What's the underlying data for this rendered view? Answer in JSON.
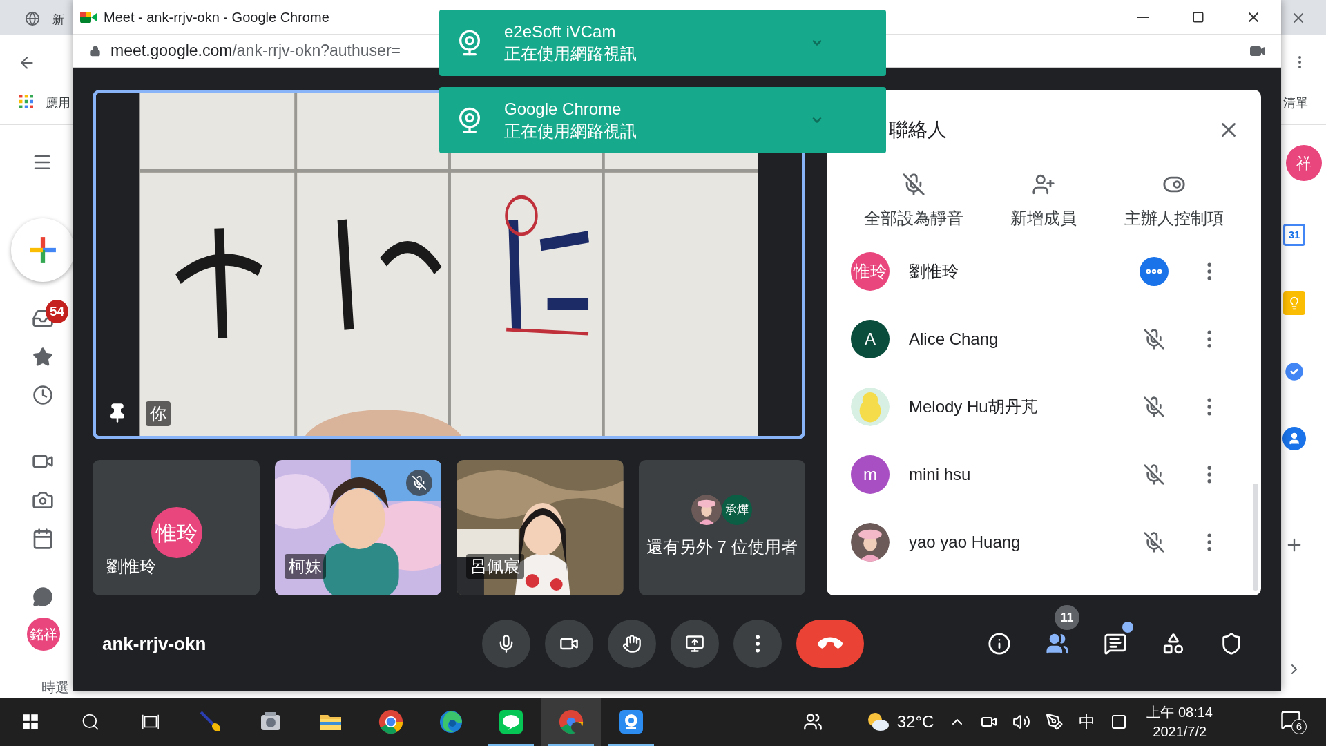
{
  "background_page": {
    "tab_title": "新",
    "bookmark": "應用",
    "right_bookmark": "清單",
    "inbox_badge": "54",
    "user_avatar": "銘祥",
    "footer_text": "時選",
    "side_avatar": "祥",
    "calendar_day": "31"
  },
  "window": {
    "title": "Meet - ank-rrjv-okn - Google Chrome",
    "url_host": "meet.google.com",
    "url_path": "/ank-rrjv-okn?authuser="
  },
  "notifications": [
    {
      "app": "e2eSoft iVCam",
      "message": "正在使用網路視訊"
    },
    {
      "app": "Google Chrome",
      "message": "正在使用網路視訊"
    }
  ],
  "main_video": {
    "label": "你",
    "pinned": true
  },
  "tiles": [
    {
      "kind": "avatar",
      "name": "劉惟玲",
      "initials": "惟玲",
      "color": "#e8467c",
      "muted": false
    },
    {
      "kind": "video",
      "name": "柯妹",
      "muted": true
    },
    {
      "kind": "video",
      "name": "呂佩宸",
      "muted": false
    },
    {
      "kind": "more",
      "label": "還有另外 7 位使用者",
      "avatars": [
        {
          "kind": "picture"
        },
        {
          "kind": "initials",
          "initials": "承燁",
          "color": "#0b5d43"
        }
      ]
    }
  ],
  "panel": {
    "title": "聯絡人",
    "actions": [
      {
        "kind": "mute_all",
        "label": "全部設為靜音"
      },
      {
        "kind": "add",
        "label": "新增成員"
      },
      {
        "kind": "host",
        "label": "主辦人控制項"
      }
    ],
    "participants": [
      {
        "name": "劉惟玲",
        "avatar": {
          "kind": "initials",
          "initials": "惟玲",
          "color": "#e8467c"
        },
        "speaking": true,
        "muted": false
      },
      {
        "name": "Alice Chang",
        "avatar": {
          "kind": "initials",
          "initials": "A",
          "color": "#0b4d3c"
        },
        "speaking": false,
        "muted": true
      },
      {
        "name": "Melody Hu胡丹芃",
        "avatar": {
          "kind": "picture"
        },
        "speaking": false,
        "muted": true
      },
      {
        "name": "mini hsu",
        "avatar": {
          "kind": "initials",
          "initials": "m",
          "color": "#a94fc4"
        },
        "speaking": false,
        "muted": true
      },
      {
        "name": "yao yao Huang",
        "avatar": {
          "kind": "picture"
        },
        "speaking": false,
        "muted": true
      }
    ]
  },
  "meeting_code": "ank-rrjv-okn",
  "controls": [
    {
      "kind": "mic"
    },
    {
      "kind": "camera"
    },
    {
      "kind": "hand"
    },
    {
      "kind": "present"
    },
    {
      "kind": "more"
    },
    {
      "kind": "end_call"
    }
  ],
  "side_controls": [
    {
      "kind": "info",
      "selected": false
    },
    {
      "kind": "people",
      "selected": true,
      "badge": "11"
    },
    {
      "kind": "chat",
      "selected": false,
      "unread": true
    },
    {
      "kind": "activities",
      "selected": false
    },
    {
      "kind": "safety",
      "selected": false
    }
  ],
  "taskbar": {
    "apps": [
      {
        "kind": "start",
        "running": false,
        "active": false
      },
      {
        "kind": "search",
        "running": false,
        "active": false
      },
      {
        "kind": "task_view",
        "running": false,
        "active": false
      },
      {
        "kind": "brush",
        "running": false,
        "active": false
      },
      {
        "kind": "app",
        "running": false,
        "active": false
      },
      {
        "kind": "folder",
        "running": false,
        "active": false
      },
      {
        "kind": "chrome",
        "running": false,
        "active": false
      },
      {
        "kind": "edge",
        "running": false,
        "active": false
      },
      {
        "kind": "line",
        "running": true,
        "active": false
      },
      {
        "kind": "chrome_meet",
        "running": true,
        "active": true
      },
      {
        "kind": "ivcam",
        "running": true,
        "active": false
      }
    ],
    "temperature": "32°C",
    "ime": "中",
    "time": "上午 08:14",
    "date": "2021/7/2",
    "notification_count": "6"
  }
}
